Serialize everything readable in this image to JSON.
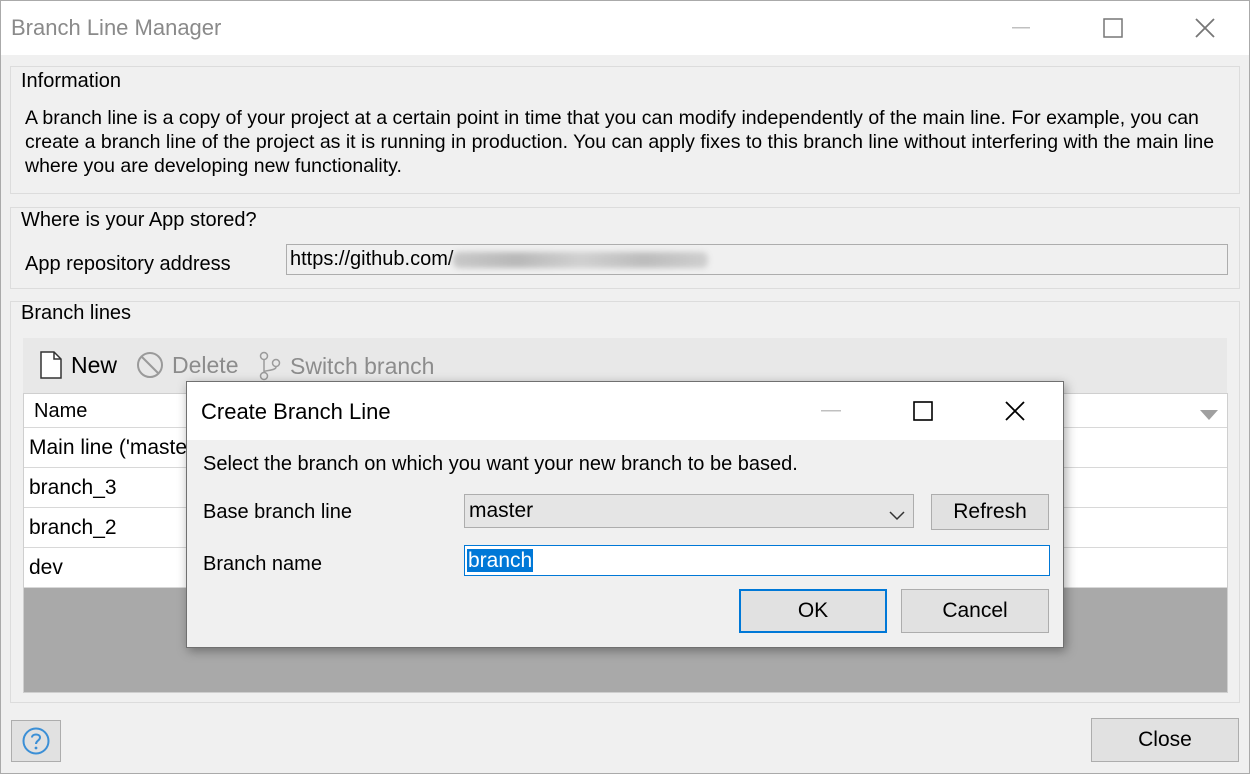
{
  "window": {
    "title": "Branch Line Manager"
  },
  "information": {
    "heading": "Information",
    "text": "A branch line is a copy of your project at a certain point in time that you can modify independently of the main line. For example, you can create a branch line of the project as it is running in production. You can apply fixes to this branch line without interfering with the main line where you are developing new functionality."
  },
  "storage": {
    "heading": "Where is your App stored?",
    "repo_label": "App repository address",
    "repo_value": "https://github.com/"
  },
  "branch_lines": {
    "heading": "Branch lines",
    "toolbar": {
      "new_label": "New",
      "delete_label": "Delete",
      "switch_label": "Switch branch"
    },
    "column_name": "Name",
    "rows": [
      "Main line ('maste",
      "branch_3",
      "branch_2",
      "dev"
    ]
  },
  "footer": {
    "close_label": "Close"
  },
  "dialog": {
    "title": "Create Branch Line",
    "prompt": "Select the branch on which you want your new branch to be based.",
    "base_label": "Base branch line",
    "base_value": "master",
    "refresh_label": "Refresh",
    "name_label": "Branch name",
    "name_value": "branch",
    "ok_label": "OK",
    "cancel_label": "Cancel"
  },
  "colors": {
    "accent": "#0078d7",
    "disabled_text": "#8c8c8c",
    "grid_empty": "#a9a9a9"
  }
}
